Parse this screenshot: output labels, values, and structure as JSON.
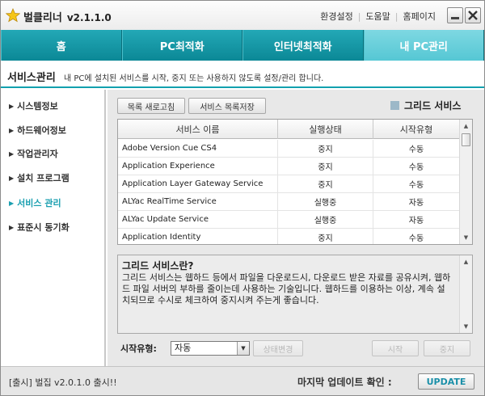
{
  "app": {
    "title": "벌클리너",
    "version": "v2.1.1.0",
    "icon": "star-icon",
    "links": [
      "환경설정",
      "도움말",
      "홈페이지"
    ]
  },
  "tabs": [
    {
      "label": "홈",
      "active": false
    },
    {
      "label": "PC최적화",
      "active": false
    },
    {
      "label": "인터넷최적화",
      "active": false
    },
    {
      "label": "내 PC관리",
      "active": true
    }
  ],
  "page": {
    "title": "서비스관리",
    "description": "내 PC에 설치된 서비스를 시작, 중지 또는 사용하지 않도록 설정/관리 합니다."
  },
  "sidebar": {
    "items": [
      {
        "label": "시스템정보",
        "active": false
      },
      {
        "label": "하드웨어정보",
        "active": false
      },
      {
        "label": "작업관리자",
        "active": false
      },
      {
        "label": "설치 프로그램",
        "active": false
      },
      {
        "label": "서비스 관리",
        "active": true
      },
      {
        "label": "표준시 동기화",
        "active": false
      }
    ]
  },
  "toolbar": {
    "refresh_label": "목록 새로고침",
    "save_label": "서비스 목록저장",
    "grid_label": "그리드 서비스"
  },
  "table": {
    "headers": [
      "서비스 이름",
      "실행상태",
      "시작유형"
    ],
    "rows": [
      [
        "Adobe Version Cue CS4",
        "중지",
        "수동"
      ],
      [
        "Application Experience",
        "중지",
        "수동"
      ],
      [
        "Application Layer Gateway Service",
        "중지",
        "수동"
      ],
      [
        "ALYac RealTime Service",
        "실행중",
        "자동"
      ],
      [
        "ALYac Update Service",
        "실행중",
        "자동"
      ],
      [
        "Application Identity",
        "중지",
        "수동"
      ]
    ]
  },
  "desc": {
    "title": "그리드 서비스란?",
    "text": "그리드 서비스는 웹하드 등에서 파일을 다운로드시, 다운로드 받은 자료를 공유시켜, 웹하드 파일 서버의 부하를 줄이는데 사용하는 기술입니다. 웹하드를 이용하는 이상, 계속 설치되므로 수시로 체크하여 중지시켜 주는게 좋습니다."
  },
  "controls": {
    "start_type_label": "시작유형:",
    "start_type_value": "자동",
    "change_state_label": "상태변경",
    "start_label": "시작",
    "stop_label": "중지"
  },
  "status": {
    "left": "[출시] 벌집 v2.0.1.0 출시!!",
    "right": "마지막 업데이트 확인 :",
    "update_label": "UPDATE"
  },
  "colors": {
    "accent": "#12a0ae",
    "tab_bg": "#0b8896",
    "tab_active": "#55c7d4",
    "sidebar_active": "#1a9fb0"
  }
}
